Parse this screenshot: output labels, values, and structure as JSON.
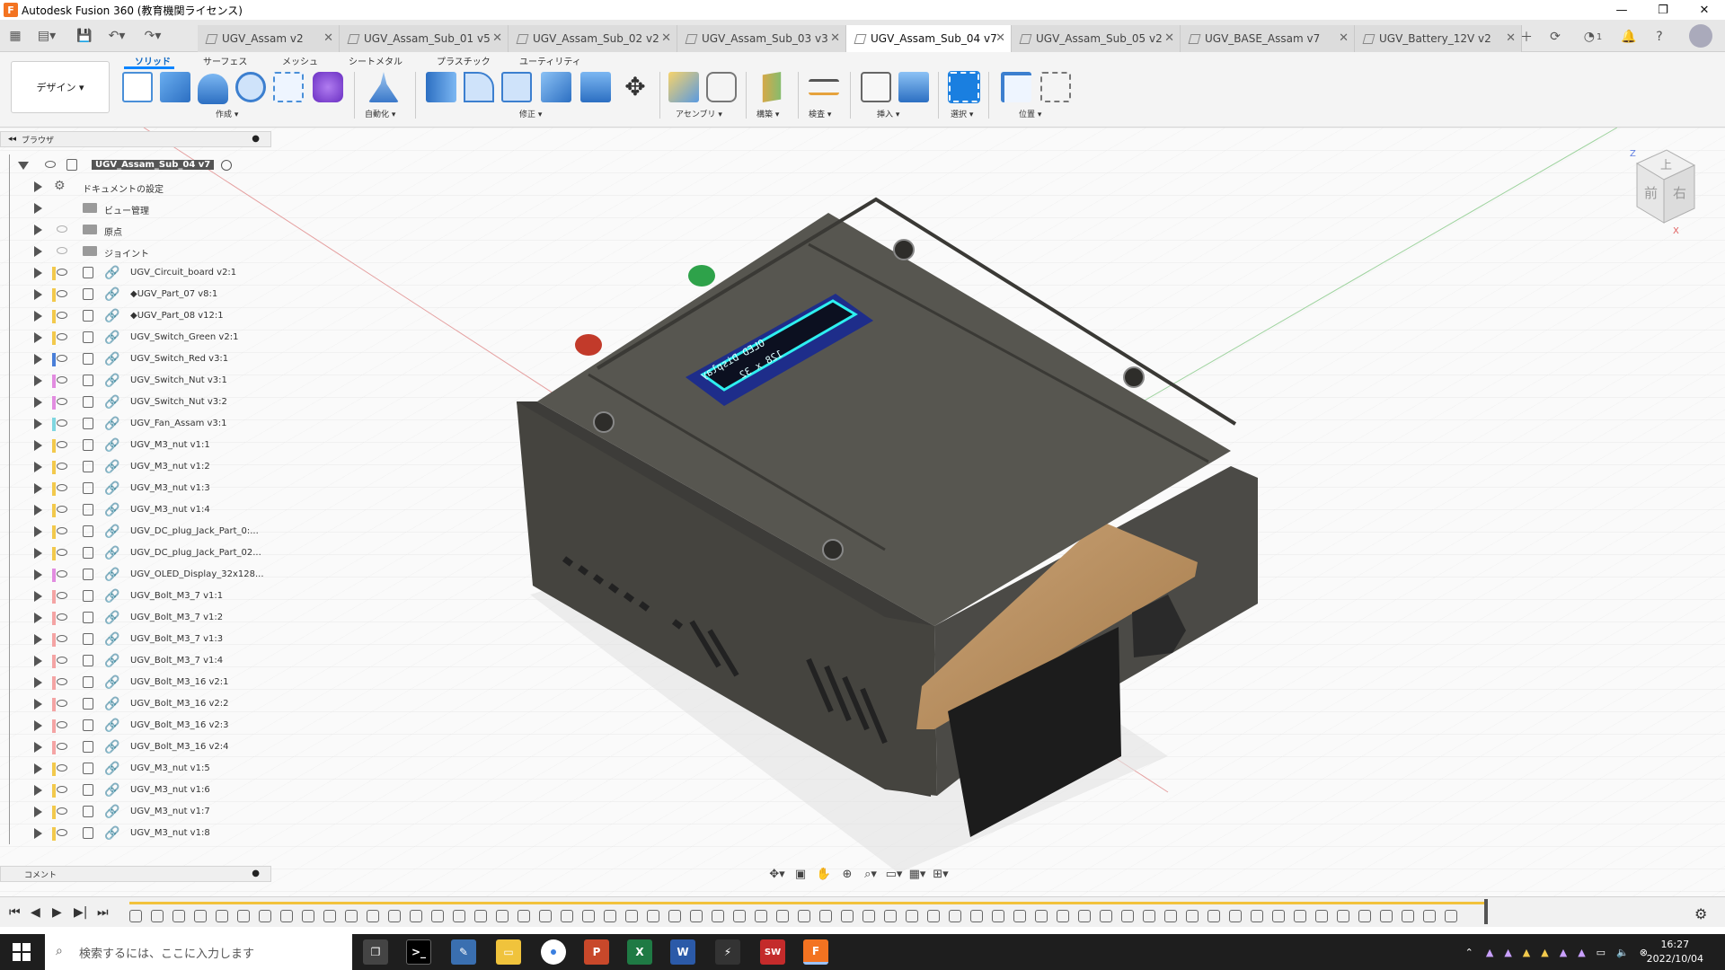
{
  "window": {
    "title": "Autodesk Fusion 360 (教育機関ライセンス)",
    "minimize_icon": "minimize-icon",
    "maximize_icon": "restore-icon",
    "close_icon": "close-icon"
  },
  "tabs": [
    {
      "label": "UGV_Assam v2",
      "active": false
    },
    {
      "label": "UGV_Assam_Sub_01 v5",
      "active": false
    },
    {
      "label": "UGV_Assam_Sub_02 v2",
      "active": false
    },
    {
      "label": "UGV_Assam_Sub_03 v3",
      "active": false
    },
    {
      "label": "UGV_Assam_Sub_04 v7",
      "active": true
    },
    {
      "label": "UGV_Assam_Sub_05 v2",
      "active": false
    },
    {
      "label": "UGV_BASE_Assam v7",
      "active": false
    },
    {
      "label": "UGV_Battery_12V v2",
      "active": false
    }
  ],
  "tabrow_right": {
    "notifications_count": "1"
  },
  "toolbar": {
    "workspace_tabs": [
      "ソリッド",
      "サーフェス",
      "メッシュ",
      "シートメタル",
      "プラスチック",
      "ユーティリティ"
    ],
    "workspace_button": "デザイン ▾",
    "groups": [
      "作成 ▾",
      "自動化 ▾",
      "修正 ▾",
      "アセンブリ ▾",
      "構築 ▾",
      "検査 ▾",
      "挿入 ▾",
      "選択 ▾",
      "位置 ▾"
    ]
  },
  "browser": {
    "title": "ブラウザ",
    "root": "UGV_Assam_Sub_04 v7",
    "items": [
      {
        "label": "ドキュメントの設定",
        "type": "settings"
      },
      {
        "label": "ビュー管理",
        "type": "folder"
      },
      {
        "label": "原点",
        "type": "folder"
      },
      {
        "label": "ジョイント",
        "type": "folder"
      },
      {
        "label": "UGV_Circuit_board v2:1",
        "color": "#f2c94c",
        "type": "comp"
      },
      {
        "label": "◆UGV_Part_07 v8:1",
        "color": "#f2c94c",
        "type": "comp"
      },
      {
        "label": "◆UGV_Part_08 v12:1",
        "color": "#f2c94c",
        "type": "comp"
      },
      {
        "label": "UGV_Switch_Green v2:1",
        "color": "#f2c94c",
        "type": "comp"
      },
      {
        "label": "UGV_Switch_Red v3:1",
        "color": "#4a7fd8",
        "type": "comp"
      },
      {
        "label": "UGV_Switch_Nut v3:1",
        "color": "#e28ce0",
        "type": "comp"
      },
      {
        "label": "UGV_Switch_Nut v3:2",
        "color": "#e28ce0",
        "type": "comp"
      },
      {
        "label": "UGV_Fan_Assam v3:1",
        "color": "#7fd6e0",
        "type": "comp"
      },
      {
        "label": "UGV_M3_nut v1:1",
        "color": "#f2c94c",
        "type": "comp"
      },
      {
        "label": "UGV_M3_nut v1:2",
        "color": "#f2c94c",
        "type": "comp"
      },
      {
        "label": "UGV_M3_nut v1:3",
        "color": "#f2c94c",
        "type": "comp"
      },
      {
        "label": "UGV_M3_nut v1:4",
        "color": "#f2c94c",
        "type": "comp"
      },
      {
        "label": "UGV_DC_plug_Jack_Part_0:...",
        "color": "#f2c94c",
        "type": "comp"
      },
      {
        "label": "UGV_DC_plug_Jack_Part_02...",
        "color": "#f2c94c",
        "type": "comp"
      },
      {
        "label": "UGV_OLED_Display_32x128...",
        "color": "#e28ce0",
        "type": "comp"
      },
      {
        "label": "UGV_Bolt_M3_7 v1:1",
        "color": "#f4a4a4",
        "type": "comp"
      },
      {
        "label": "UGV_Bolt_M3_7 v1:2",
        "color": "#f4a4a4",
        "type": "comp"
      },
      {
        "label": "UGV_Bolt_M3_7 v1:3",
        "color": "#f4a4a4",
        "type": "comp"
      },
      {
        "label": "UGV_Bolt_M3_7 v1:4",
        "color": "#f4a4a4",
        "type": "comp"
      },
      {
        "label": "UGV_Bolt_M3_16 v2:1",
        "color": "#f4a4a4",
        "type": "comp"
      },
      {
        "label": "UGV_Bolt_M3_16 v2:2",
        "color": "#f4a4a4",
        "type": "comp"
      },
      {
        "label": "UGV_Bolt_M3_16 v2:3",
        "color": "#f4a4a4",
        "type": "comp"
      },
      {
        "label": "UGV_Bolt_M3_16 v2:4",
        "color": "#f4a4a4",
        "type": "comp"
      },
      {
        "label": "UGV_M3_nut v1:5",
        "color": "#f2c94c",
        "type": "comp"
      },
      {
        "label": "UGV_M3_nut v1:6",
        "color": "#f2c94c",
        "type": "comp"
      },
      {
        "label": "UGV_M3_nut v1:7",
        "color": "#f2c94c",
        "type": "comp"
      },
      {
        "label": "UGV_M3_nut v1:8",
        "color": "#f2c94c",
        "type": "comp"
      }
    ]
  },
  "comment": {
    "title": "コメント"
  },
  "viewcube": {
    "front": "前",
    "right": "右",
    "top": "上",
    "z_axis": "Z",
    "x_axis": "X"
  },
  "oled": {
    "line1": "OLED Display",
    "line2": "128 x 32"
  },
  "taskbar": {
    "search_placeholder": "検索するには、ここに入力します",
    "time": "16:27",
    "date": "2022/10/04",
    "apps": [
      "P",
      "X",
      "W",
      "SW",
      "F"
    ]
  },
  "colors": {
    "accent": "#0b84ff",
    "fusion_orange": "#f37321",
    "model_gray": "#4a4945",
    "board": "#b58b5a"
  }
}
